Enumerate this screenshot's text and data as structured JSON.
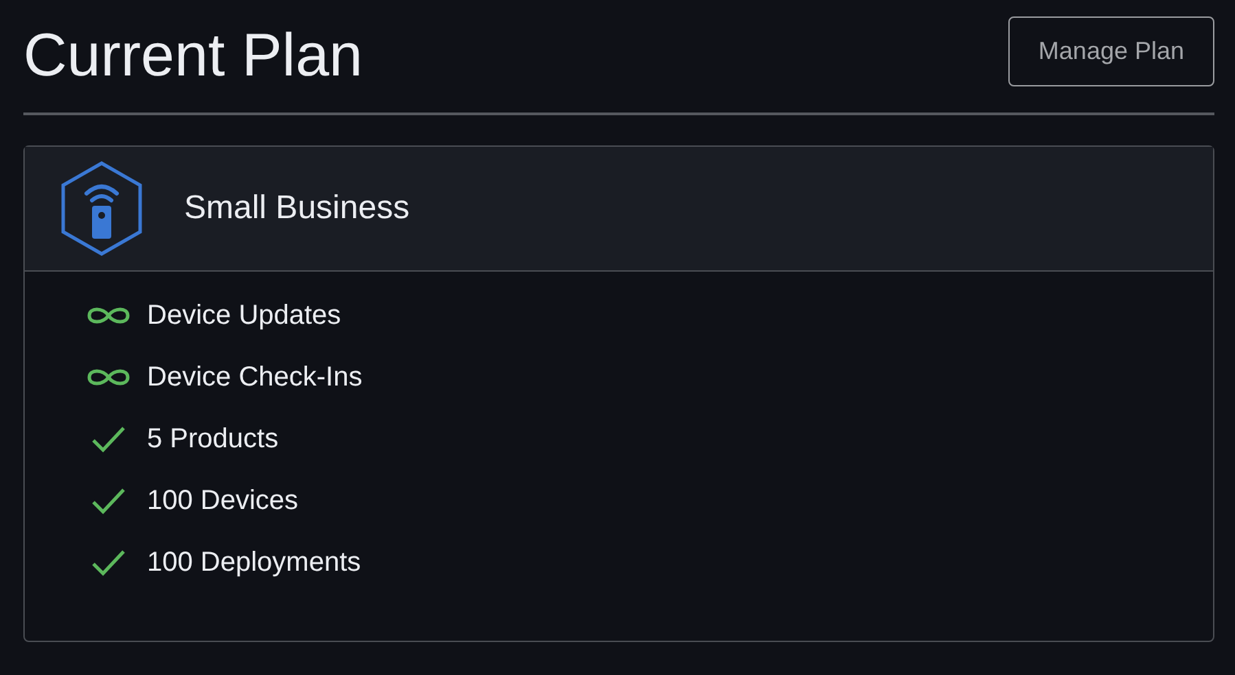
{
  "title": "Current Plan",
  "manage_button": "Manage Plan",
  "plan": {
    "name": "Small Business",
    "features": [
      {
        "kind": "unlimited",
        "label": "Device Updates"
      },
      {
        "kind": "unlimited",
        "label": "Device Check-Ins"
      },
      {
        "kind": "included",
        "label": "5 Products"
      },
      {
        "kind": "included",
        "label": "100 Devices"
      },
      {
        "kind": "included",
        "label": "100 Deployments"
      }
    ]
  }
}
